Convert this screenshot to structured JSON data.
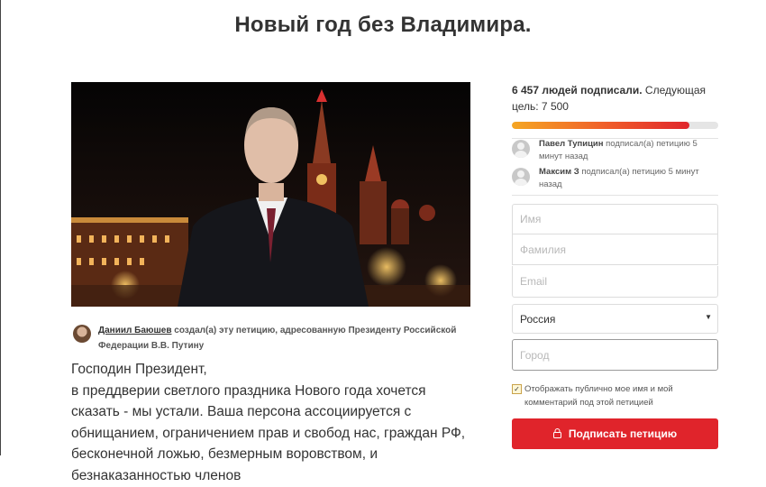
{
  "title": "Новый год без Владимира.",
  "creator": {
    "name": "Даниил Баюшев",
    "text": " создал(а) эту петицию, адресованную Президенту Российской Федерации В.В. Путину"
  },
  "body_text": "Господин Президент,\nв преддверии светлого праздника Нового года хочется сказать - мы устали. Ваша персона ассоциируется с обнищанием, ограничением прав и свобод нас, граждан РФ, бесконечной ложью, безмерным воровством, и безнаказанностью членов",
  "signatures": {
    "count_label": "6 457 людей подписали.",
    "goal_label": " Следующая цель: 7 500",
    "progress_fraction": 0.86
  },
  "recent_signers": [
    {
      "name": "Павел Тупицин",
      "action": " подписал(а) петицию 5 минут назад"
    },
    {
      "name": "Максим З",
      "action": " подписал(а) петицию 5 минут назад"
    }
  ],
  "form": {
    "first_name_placeholder": "Имя",
    "last_name_placeholder": "Фамилия",
    "email_placeholder": "Email",
    "country_value": "Россия",
    "city_placeholder": "Город",
    "consent_checked": true,
    "consent_label": "Отображать публично мое имя и мой комментарий под этой петицией",
    "submit_label": "Подписать петицию"
  },
  "colors": {
    "accent": "#e0242b",
    "progress_start": "#f5a623",
    "progress_end": "#e0262c"
  },
  "icons": {
    "submit": "lock-icon",
    "country_select": "caret-down-icon",
    "consent": "checkbox-checked-icon"
  }
}
